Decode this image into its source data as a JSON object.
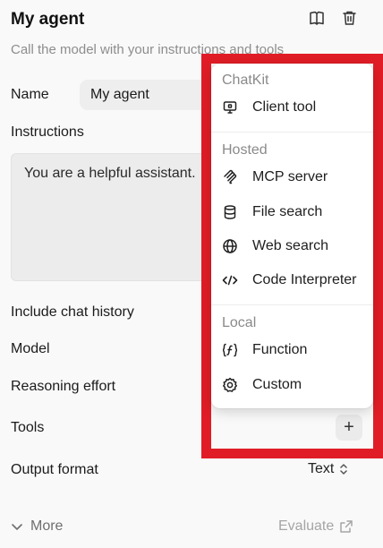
{
  "header": {
    "title": "My agent",
    "subtitle": "Call the model with your instructions and tools"
  },
  "form": {
    "name_label": "Name",
    "name_value": "My agent",
    "instructions_label": "Instructions",
    "instructions_value": "You are a helpful assistant.",
    "chat_history_label": "Include chat history",
    "model_label": "Model",
    "reasoning_label": "Reasoning effort",
    "tools_label": "Tools",
    "add_tool_label": "+",
    "output_label": "Output format",
    "output_value": "Text"
  },
  "footer": {
    "more_label": "More",
    "evaluate_label": "Evaluate"
  },
  "tool_menu": {
    "sections": [
      {
        "heading": "ChatKit",
        "items": [
          {
            "label": "Client tool",
            "icon": "client-tool-icon"
          }
        ]
      },
      {
        "heading": "Hosted",
        "items": [
          {
            "label": "MCP server",
            "icon": "mcp-icon"
          },
          {
            "label": "File search",
            "icon": "database-icon"
          },
          {
            "label": "Web search",
            "icon": "globe-icon"
          },
          {
            "label": "Code Interpreter",
            "icon": "code-icon"
          }
        ]
      },
      {
        "heading": "Local",
        "items": [
          {
            "label": "Function",
            "icon": "function-icon"
          },
          {
            "label": "Custom",
            "icon": "gear-icon"
          }
        ]
      }
    ]
  },
  "colors": {
    "highlight": "#e01d26",
    "background": "#f9f9f9",
    "input_bg": "#eeeeee"
  }
}
